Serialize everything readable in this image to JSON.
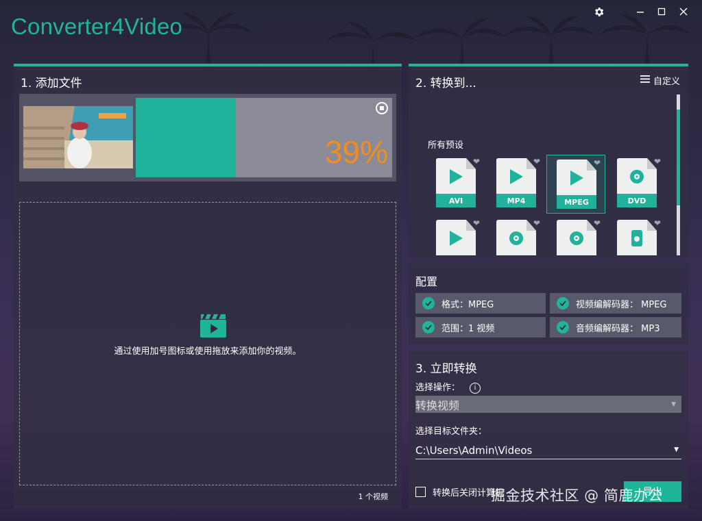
{
  "app": {
    "title": "Converter4Video"
  },
  "window": {
    "settings_icon": "gear-icon",
    "minimize_icon": "minimize-icon",
    "maximize_icon": "maximize-icon",
    "close_icon": "close-icon"
  },
  "colors": {
    "accent": "#1fb59b",
    "progress_text": "#f28d1e"
  },
  "add_files": {
    "title": "1. 添加文件",
    "item": {
      "progress": 0.39,
      "progress_label": "39%",
      "stop_icon": "stop-icon"
    },
    "drop_text": "通过使用加号图标或使用拖放来添加你的视频。",
    "drop_icon": "clapperboard-icon",
    "count": "1 个视频"
  },
  "convert_to": {
    "title": "2. 转换到...",
    "custom_label": "自定义",
    "presets_label": "所有预设",
    "presets": [
      {
        "label": "AVI",
        "icon": "play-icon",
        "selected": false
      },
      {
        "label": "MP4",
        "icon": "play-icon",
        "selected": false
      },
      {
        "label": "MPEG",
        "icon": "play-icon",
        "selected": true
      },
      {
        "label": "DVD",
        "icon": "disc-icon",
        "selected": false
      },
      {
        "label": "",
        "icon": "play-icon",
        "selected": false
      },
      {
        "label": "",
        "icon": "disc-icon",
        "selected": false
      },
      {
        "label": "",
        "icon": "disc-icon",
        "selected": false
      },
      {
        "label": "",
        "icon": "apple-device-icon",
        "selected": false
      }
    ]
  },
  "config": {
    "title": "配置",
    "items": [
      "格式：MPEG",
      "视频编解码器： MPEG",
      "范围：1 视频",
      "音频编解码器： MP3"
    ]
  },
  "convert_now": {
    "title": "3. 立即转换",
    "action_label": "选择操作：",
    "action_value": "转换视频",
    "folder_label": "选择目标文件夹：",
    "folder_value": "C:\\Users\\Admin\\Videos",
    "close_after": "转换后关闭计算机",
    "export_button": "导出"
  },
  "watermark": "掘金技术社区 @ 简鹿办公"
}
